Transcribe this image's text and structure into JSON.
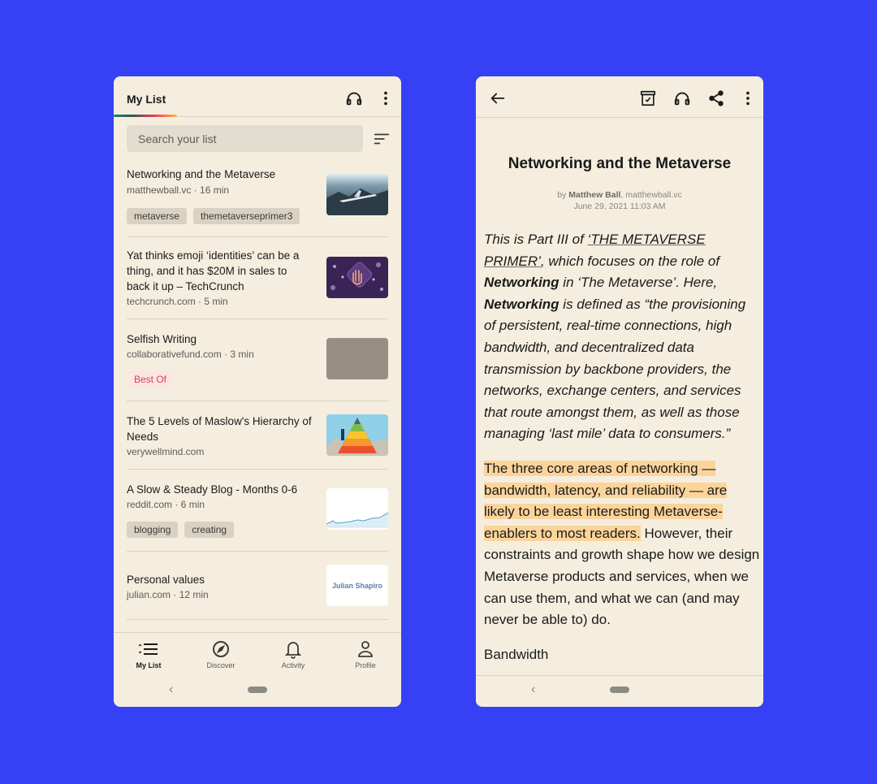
{
  "colors": {
    "background": "#3641f5",
    "surface": "#f5eedf",
    "highlight": "#fcd49a",
    "best_of_tag": "#d8435a"
  },
  "left": {
    "header": {
      "title": "My List",
      "icons": [
        "headphones-icon",
        "more-vert-icon"
      ]
    },
    "search": {
      "placeholder": "Search your list",
      "value": ""
    },
    "sort_icon": "sort-icon",
    "items": [
      {
        "title": "Networking and the Metaverse",
        "meta": "matthewball.vc · 16 min",
        "tags": [
          "metaverse",
          "themetaverseprimer3"
        ],
        "thumbnail": "airplane-over-mountains"
      },
      {
        "title": "Yat thinks emoji ‘identities’ can be a thing, and it has $20M in sales to back it up – TechCrunch",
        "meta": "techcrunch.com · 5 min",
        "tags": [],
        "thumbnail": "purple-hand-emoji"
      },
      {
        "title": "Selfish Writing",
        "meta": "collaborativefund.com · 3 min",
        "tags": [
          "Best Of"
        ],
        "thumbnail": "gray-texture"
      },
      {
        "title": "The 5 Levels of Maslow's Hierarchy of Needs",
        "meta": "verywellmind.com",
        "tags": [],
        "thumbnail": "maslow-pyramid"
      },
      {
        "title": "A Slow & Steady Blog - Months 0-6",
        "meta": "reddit.com · 6 min",
        "tags": [
          "blogging",
          "creating"
        ],
        "thumbnail": "line-chart"
      },
      {
        "title": "Personal values",
        "meta": "julian.com · 12 min",
        "tags": [],
        "thumbnail": "julian-shapiro-logo",
        "thumbnail_text": "Julian Shapiro"
      }
    ],
    "bottom_nav": [
      {
        "label": "My List",
        "icon": "list-icon",
        "active": true
      },
      {
        "label": "Discover",
        "icon": "compass-icon",
        "active": false
      },
      {
        "label": "Activity",
        "icon": "bell-icon",
        "active": false
      },
      {
        "label": "Profile",
        "icon": "person-icon",
        "active": false
      }
    ],
    "system_nav": {
      "back": "‹"
    }
  },
  "right": {
    "header": {
      "icons": [
        "back-arrow-icon",
        "archive-icon",
        "headphones-icon",
        "share-icon",
        "more-vert-icon"
      ]
    },
    "article": {
      "title": "Networking and the Metaverse",
      "by_prefix": "by",
      "author": "Matthew Ball",
      "source": ", matthewball.vc",
      "date": "June 29, 2021 11:03 AM",
      "p1": {
        "t1": "This is Part III of ",
        "link": "‘THE METAVERSE PRIMER’",
        "t2": ", which focuses on the role of ",
        "b1": "Networking",
        "t3": " in ‘The Metaverse’. Here, ",
        "b2": "Networking",
        "t4": " is defined as “the provisioning of persistent, real-time connections, high bandwidth, and decentralized data transmission by backbone providers, the networks, exchange centers, and services that route amongst them, as well as those managing ‘last mile’ data to consumers.”"
      },
      "p2": {
        "highlighted": "The three core areas of networking — bandwidth, latency, and reliability — are likely to be least interesting Metaverse-enablers to most readers.",
        "rest": " However, their constraints and growth shape how we design Metaverse products and services, when we can use them, and what we can (and may never be able to) do."
      },
      "p3_partial": "Bandwidth"
    },
    "system_nav": {
      "back": "‹"
    }
  }
}
